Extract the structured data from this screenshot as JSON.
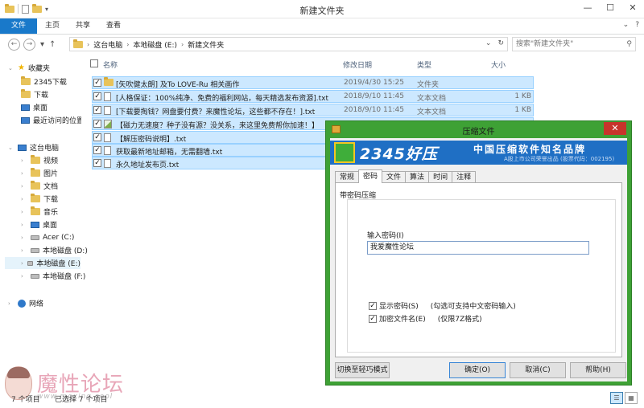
{
  "window": {
    "title": "新建文件夹",
    "controls": [
      "—",
      "☐",
      "✕"
    ]
  },
  "ribbon": {
    "tabs": [
      "文件",
      "主页",
      "共享",
      "查看"
    ],
    "help_icons": [
      "⌄",
      "?"
    ]
  },
  "address": {
    "crumbs": [
      "这台电脑",
      "本地磁盘 (E:)",
      "新建文件夹"
    ],
    "search_placeholder": "搜索\"新建文件夹\""
  },
  "nav": {
    "favorites_label": "收藏夹",
    "favorites": [
      "2345下载",
      "下载",
      "桌面",
      "最近访问的位置"
    ],
    "pc_label": "这台电脑",
    "pc_items": [
      "视频",
      "图片",
      "文档",
      "下载",
      "音乐",
      "桌面",
      "Acer (C:)",
      "本地磁盘 (D:)",
      "本地磁盘 (E:)",
      "本地磁盘 (F:)"
    ],
    "network_label": "网络"
  },
  "columns": {
    "name": "名称",
    "date": "修改日期",
    "type": "类型",
    "size": "大小"
  },
  "files": [
    {
      "name": "[矢吹健太朗] 及To LOVE-Ru 相关画作",
      "date": "2019/4/30 15:25",
      "type": "文件夹",
      "size": "",
      "icon": "folder-icon",
      "checked": true
    },
    {
      "name": "[人格保证：100%纯净、免费的福利网站，每天精选发布资源].txt",
      "date": "2018/9/10 11:45",
      "type": "文本文档",
      "size": "1 KB",
      "icon": "text-file-icon",
      "checked": true
    },
    {
      "name": "[下载要掏钱？网盘要付费？来魔性论坛，这些都不存在！].txt",
      "date": "2018/9/10 11:45",
      "type": "文本文档",
      "size": "1 KB",
      "icon": "text-file-icon",
      "checked": true
    },
    {
      "name": "【磁力无速度？种子没有源？没关系，来这里免费帮你加速！】",
      "date": "",
      "type": "",
      "size": "",
      "icon": "url-shortcut-icon",
      "checked": true
    },
    {
      "name": "【解压密码说明】.txt",
      "date": "",
      "type": "",
      "size": "",
      "icon": "text-file-icon",
      "checked": true
    },
    {
      "name": "获取最新地址邮箱，无需翻墙.txt",
      "date": "",
      "type": "",
      "size": "",
      "icon": "text-file-icon",
      "checked": true
    },
    {
      "name": "永久地址发布页.txt",
      "date": "",
      "type": "",
      "size": "",
      "icon": "text-file-icon",
      "checked": true
    }
  ],
  "status": {
    "count": "7 个项目",
    "selected": "已选择 7 个项目"
  },
  "watermark": {
    "text": "魔性论坛",
    "url": "www.moxing.cool"
  },
  "dialog": {
    "title": "压缩文件",
    "close": "✕",
    "banner_brand": "2345好压",
    "banner_slogan": "中国压缩软件知名品牌",
    "banner_sub": "A股上市公司荣誉出品 (股票代码：002195)",
    "tabs": [
      "常规",
      "密码",
      "文件",
      "算法",
      "时间",
      "注释"
    ],
    "active_tab": "密码",
    "group_title": "带密码压缩",
    "password_label": "输入密码(I)",
    "password_value": "我爱魔性论坛",
    "show_password": {
      "label": "显示密码(S)",
      "hint": "(勾选可支持中文密码输入)",
      "checked": true
    },
    "encrypt_names": {
      "label": "加密文件名(E)",
      "hint": "(仅限7Z格式)",
      "checked": true
    },
    "buttons": {
      "simple_mode": "切换至轻巧模式",
      "ok": "确定(O)",
      "cancel": "取消(C)",
      "help": "帮助(H)"
    }
  }
}
